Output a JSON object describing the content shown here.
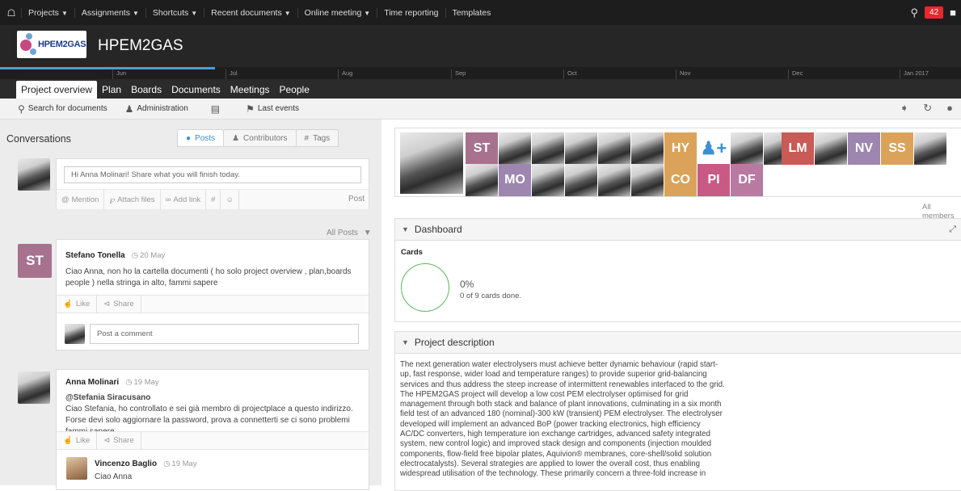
{
  "topbar": {
    "menu": [
      {
        "label": "Projects",
        "dropdown": true
      },
      {
        "label": "Assignments",
        "dropdown": true
      },
      {
        "label": "Shortcuts",
        "dropdown": true
      },
      {
        "label": "Recent documents",
        "dropdown": true
      },
      {
        "label": "Online meeting",
        "dropdown": true
      },
      {
        "label": "Time reporting",
        "dropdown": false
      },
      {
        "label": "Templates",
        "dropdown": false
      }
    ],
    "notification_count": "42"
  },
  "project": {
    "logo_text": "HPEM2GAS",
    "title": "HPEM2GAS"
  },
  "timeline": {
    "months": [
      "Jun",
      "Jul",
      "Aug",
      "Sep",
      "Oct",
      "Nov",
      "Dec",
      "Jan 2017"
    ]
  },
  "nav_tabs": [
    "Project overview",
    "Plan",
    "Boards",
    "Documents",
    "Meetings",
    "People"
  ],
  "toolbar": {
    "search": "Search for documents",
    "administration": "Administration",
    "last_events": "Last events"
  },
  "conversations": {
    "title": "Conversations",
    "tabs": {
      "posts": "Posts",
      "contributors": "Contributors",
      "tags": "Tags"
    },
    "compose_placeholder": "Hi Anna Molinari! Share what you will finish today.",
    "compose_actions": {
      "mention": "Mention",
      "attach": "Attach files",
      "link": "Add link",
      "hash": "#",
      "post": "Post"
    },
    "filter": "All Posts",
    "like": "Like",
    "share": "Share",
    "comment_placeholder": "Post a comment",
    "posts": [
      {
        "initials": "ST",
        "author": "Stefano Tonella",
        "date": "20 May",
        "text": "Ciao Anna, non ho la cartella documenti ( ho solo project overview , plan,boards people ) nella stringa in alto, fammi sapere"
      },
      {
        "author": "Anna Molinari",
        "date": "19 May",
        "mention": "@Stefania Siracusano",
        "text": "Ciao Stefania, ho controllato e sei già membro di projectplace a questo indirizzo. Forse devi solo aggiornare la password, prova a connetterti se ci sono problemi fammi sapere",
        "reply": {
          "author": "Vincenzo Baglio",
          "date": "19 May",
          "text": "Ciao Anna"
        }
      }
    ]
  },
  "members": {
    "initials": [
      "ST",
      "HY",
      "LM",
      "NV",
      "SS",
      "MO",
      "CO",
      "PI",
      "DF"
    ],
    "all_members": "All members"
  },
  "dashboard": {
    "title": "Dashboard",
    "cards_label": "Cards",
    "percent": "0%",
    "summary": "0 of 9 cards done."
  },
  "project_description": {
    "title": "Project description",
    "lines": [
      "The next generation water electrolysers must achieve better dynamic behaviour (rapid start-",
      "up, fast response, wider load and temperature ranges) to provide superior grid-balancing",
      "services and thus address the steep increase of intermittent renewables interfaced to the grid.",
      "The HPEM2GAS project will develop a low cost PEM electrolyser optimised for grid",
      "management through both stack and balance of plant innovations, culminating in a six month",
      "field test of an advanced 180 (nominal)-300 kW (transient) PEM electrolyser. The electrolyser",
      "developed will implement an advanced BoP (power tracking electronics, high efficiency",
      "AC/DC converters, high temperature ion exchange cartridges, advanced safety integrated",
      "system, new control logic) and improved stack design and components (injection moulded",
      "components, flow-field free bipolar plates, Aquivion® membranes, core-shell/solid solution",
      "electrocatalysts). Several strategies are applied to lower the overall cost, thus enabling",
      "widespread utilisation of the technology. These primarily concern a three-fold increase in"
    ]
  },
  "colors": {
    "accent": "#3b8fd6",
    "badge": "#e8282b",
    "st": "#a6728e",
    "hy": "#dba359",
    "lm": "#c95a55",
    "nv": "#9d86b0",
    "ss": "#dba359"
  }
}
